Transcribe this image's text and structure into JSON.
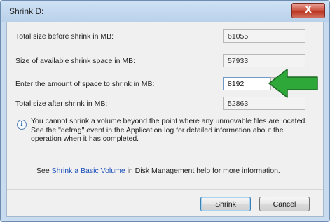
{
  "window": {
    "title": "Shrink D:",
    "close_label": "X"
  },
  "rows": [
    {
      "label": "Total size before shrink in MB:",
      "value": "61055"
    },
    {
      "label": "Size of available shrink space in MB:",
      "value": "57933"
    },
    {
      "label": "Enter the amount of space to shrink in MB:",
      "value": "8192"
    },
    {
      "label": "Total size after shrink in MB:",
      "value": "52863"
    }
  ],
  "info": {
    "icon": "info-icon",
    "text": "You cannot shrink a volume beyond the point where any unmovable files are located. See the \"defrag\" event in the Application log for detailed information about the operation when it has completed."
  },
  "help": {
    "prefix": "See ",
    "link": "Shrink a Basic Volume",
    "suffix": " in Disk Management help for more information."
  },
  "buttons": {
    "shrink_label": "Shrink",
    "cancel_label": "Cancel"
  },
  "annotation": {
    "arrow_color": "#2fa83a",
    "arrow_icon": "green-arrow-left-icon"
  }
}
